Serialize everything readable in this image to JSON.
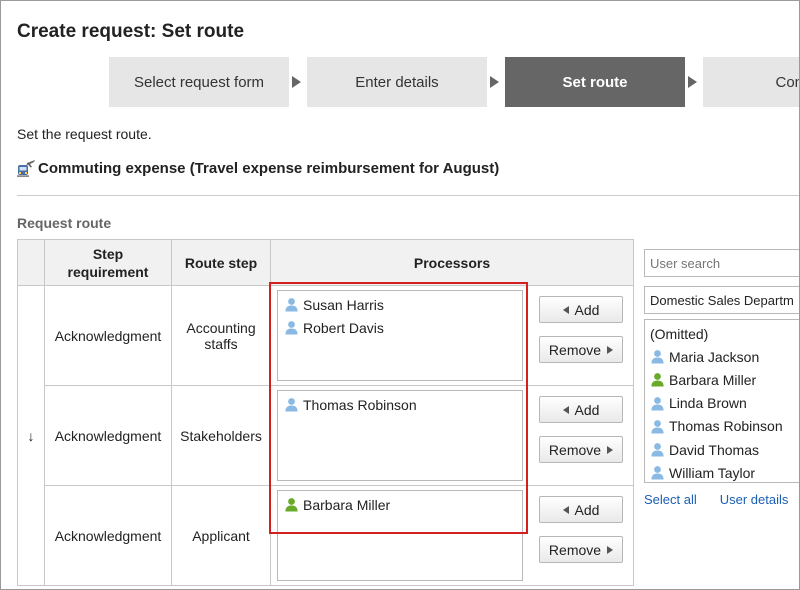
{
  "page_title": "Create request: Set route",
  "steps": [
    {
      "label": "Select request form",
      "active": false
    },
    {
      "label": "Enter details",
      "active": false
    },
    {
      "label": "Set route",
      "active": true
    },
    {
      "label": "Confi",
      "active": false
    }
  ],
  "intro_text": "Set the request route.",
  "form": {
    "icon": "commute-train-plane-icon",
    "name": "Commuting expense (Travel expense reimbursement for August)"
  },
  "section_label": "Request route",
  "table": {
    "headers": {
      "step_requirement": "Step requirement",
      "route_step": "Route step",
      "processors": "Processors"
    },
    "arrow": "↓",
    "rows": [
      {
        "requirement": "Acknowledgment",
        "route_step": "Accounting staffs",
        "processors": [
          {
            "name": "Susan Harris",
            "icon": "user-blue-icon"
          },
          {
            "name": "Robert Davis",
            "icon": "user-blue-icon"
          }
        ]
      },
      {
        "requirement": "Acknowledgment",
        "route_step": "Stakeholders",
        "processors": [
          {
            "name": "Thomas Robinson",
            "icon": "user-blue-icon"
          }
        ]
      },
      {
        "requirement": "Acknowledgment",
        "route_step": "Applicant",
        "processors": [
          {
            "name": "Barbara Miller",
            "icon": "user-green-icon"
          }
        ]
      }
    ],
    "add_label": "Add",
    "remove_label": "Remove"
  },
  "user_search": {
    "placeholder": "User search",
    "department": "Domestic Sales Departm",
    "users": [
      {
        "name": "(Omitted)",
        "icon": ""
      },
      {
        "name": "Maria Jackson",
        "icon": "user-blue-icon"
      },
      {
        "name": "Barbara Miller",
        "icon": "user-green-icon"
      },
      {
        "name": "Linda Brown",
        "icon": "user-blue-icon"
      },
      {
        "name": "Thomas Robinson",
        "icon": "user-blue-icon"
      },
      {
        "name": "David Thomas",
        "icon": "user-blue-icon"
      },
      {
        "name": "William Taylor",
        "icon": "user-blue-icon"
      }
    ],
    "select_all": "Select all",
    "user_details": "User details"
  },
  "colors": {
    "active_step_bg": "#666666",
    "highlight_border": "#d21f1f",
    "user_blue": "#7fb2e0",
    "user_green": "#6aaa2a",
    "link": "#1a5fb4"
  }
}
